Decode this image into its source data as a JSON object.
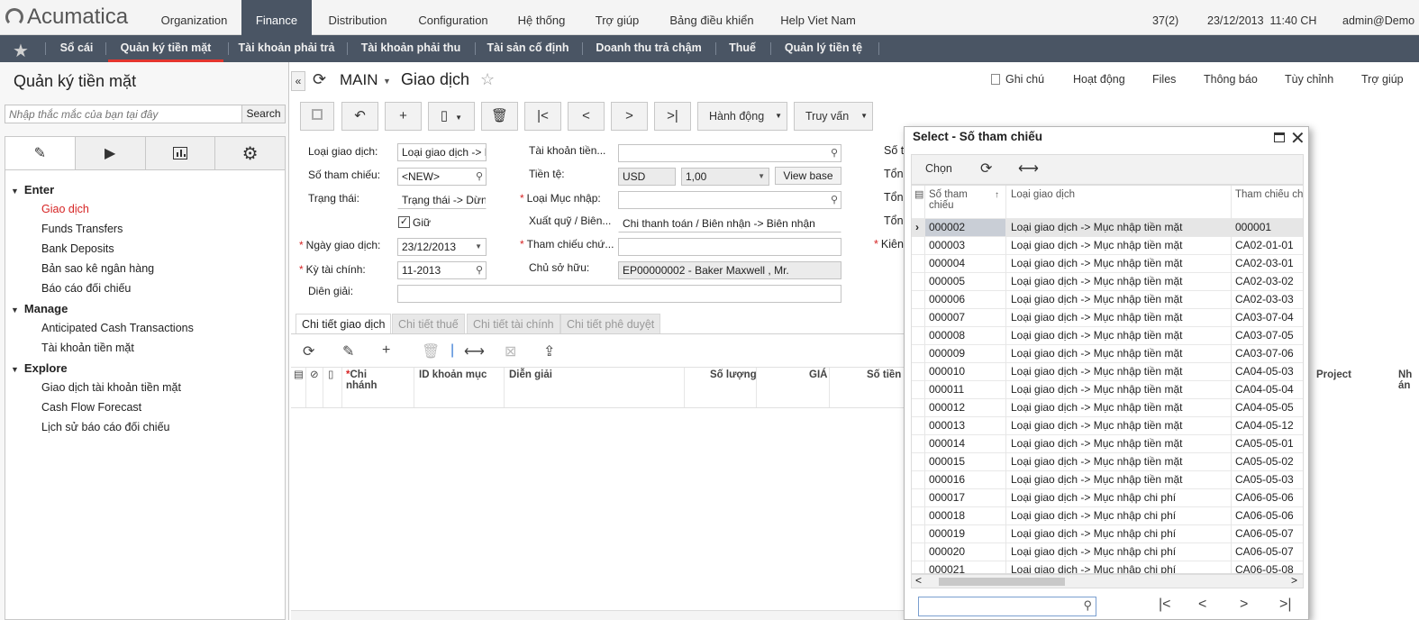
{
  "app": {
    "brand": "Acumatica"
  },
  "topnav": {
    "items": [
      "Organization",
      "Finance",
      "Distribution",
      "Configuration",
      "Hệ thống",
      "Trợ giúp",
      "Bảng điều khiển",
      "Help Viet Nam"
    ],
    "active": "Finance",
    "counter": "37(2)",
    "datetime": "23/12/2013  11:40 CH",
    "user": "admin@Demo"
  },
  "subnav": {
    "items": [
      "Sổ cái",
      "Quản ký tiền mặt",
      "Tài khoản phải trả",
      "Tài khoản phải thu",
      "Tài sản cố định",
      "Doanh thu trả chậm",
      "Thuế",
      "Quản lý tiền tệ"
    ],
    "active": "Quản ký tiền mặt"
  },
  "sidebar": {
    "title": "Quản ký tiền mặt",
    "search_placeholder": "Nhập thắc mắc của bạn tại đây",
    "search_button": "Search",
    "groups": [
      {
        "label": "Enter",
        "items": [
          "Giao dịch",
          "Funds Transfers",
          "Bank Deposits",
          "Bản sao kê ngân hàng",
          "Báo cáo đối chiếu"
        ]
      },
      {
        "label": "Manage",
        "items": [
          "Anticipated Cash Transactions",
          "Tài khoản tiền mặt"
        ]
      },
      {
        "label": "Explore",
        "items": [
          "Giao dịch tài khoản tiền mặt",
          "Cash Flow Forecast",
          "Lịch sử báo cáo đối chiếu"
        ]
      }
    ],
    "active_item": "Giao dịch"
  },
  "page": {
    "company": "MAIN",
    "title": "Giao dịch",
    "links": [
      "Ghi chú",
      "Hoạt động",
      "Files",
      "Thông báo",
      "Tùy chỉnh",
      "Trợ giúp"
    ],
    "toolbar": {
      "actions": "Hành động",
      "inquiry": "Truy vấn"
    }
  },
  "form": {
    "loai_giao_dich_label": "Loại giao dịch:",
    "loai_giao_dich_value": "Loại giao dịch -> Mục nhập tiền mặt",
    "so_tham_chieu_label": "Số tham chiếu:",
    "so_tham_chieu_value": "<NEW>",
    "trang_thai_label": "Trạng thái:",
    "trang_thai_value": "Trạng thái -> Dừng",
    "giu_label": "Giữ",
    "ngay_label": "Ngày giao dịch:",
    "ngay_value": "23/12/2013",
    "ky_label": "Kỳ tài chính:",
    "ky_value": "11-2013",
    "dien_giai_label": "Diên giải:",
    "tk_tien_label": "Tài khoản tiền...",
    "tien_te_label": "Tiền tệ:",
    "tien_te_value": "USD",
    "rate_value": "1,00",
    "view_base": "View base",
    "loai_muc_nhap_label": "Loại Mục nhập:",
    "xuat_quy_label": "Xuất quỹ / Biên...",
    "xuat_quy_value": "Chi thanh toán / Biên nhận -> Biên nhận",
    "tham_chieu_chu_label": "Tham chiếu chứ...",
    "chu_so_huu_label": "Chủ sở hữu:",
    "chu_so_huu_value": "EP00000002 - Baker Maxwell , Mr.",
    "right_labels": [
      "Số t",
      "Tổng",
      "Tổng",
      "Tổng",
      "Kiên"
    ]
  },
  "tabs": [
    "Chi tiết giao dịch",
    "Chi tiết thuế",
    "Chi tiết tài chính",
    "Chi tiết phê duyệt"
  ],
  "grid": {
    "headers": [
      "Chi nhánh",
      "ID khoản mục",
      "Diễn giải",
      "Số lượng",
      "GIÁ",
      "Số tiền",
      "Project",
      "Nh án"
    ]
  },
  "dialog": {
    "title": "Select - Số tham chiếu",
    "select_button": "Chọn",
    "headers": [
      "Số tham chiếu",
      "Loại giao dịch",
      "Tham chiếu chi"
    ],
    "rows": [
      [
        "000002",
        "Loại giao dịch -> Mục nhập tiền mặt",
        "000001"
      ],
      [
        "000003",
        "Loại giao dịch -> Mục nhập tiền mặt",
        "CA02-01-01"
      ],
      [
        "000004",
        "Loại giao dịch -> Mục nhập tiền mặt",
        "CA02-03-01"
      ],
      [
        "000005",
        "Loại giao dịch -> Mục nhập tiền mặt",
        "CA02-03-02"
      ],
      [
        "000006",
        "Loại giao dịch -> Mục nhập tiền mặt",
        "CA02-03-03"
      ],
      [
        "000007",
        "Loại giao dịch -> Mục nhập tiền mặt",
        "CA03-07-04"
      ],
      [
        "000008",
        "Loại giao dịch -> Mục nhập tiền mặt",
        "CA03-07-05"
      ],
      [
        "000009",
        "Loại giao dịch -> Mục nhập tiền mặt",
        "CA03-07-06"
      ],
      [
        "000010",
        "Loại giao dịch -> Mục nhập tiền mặt",
        "CA04-05-03"
      ],
      [
        "000011",
        "Loại giao dịch -> Mục nhập tiền mặt",
        "CA04-05-04"
      ],
      [
        "000012",
        "Loại giao dịch -> Mục nhập tiền mặt",
        "CA04-05-05"
      ],
      [
        "000013",
        "Loại giao dịch -> Mục nhập tiền mặt",
        "CA04-05-12"
      ],
      [
        "000014",
        "Loại giao dịch -> Mục nhập tiền mặt",
        "CA05-05-01"
      ],
      [
        "000015",
        "Loại giao dịch -> Mục nhập tiền mặt",
        "CA05-05-02"
      ],
      [
        "000016",
        "Loại giao dịch -> Mục nhập tiền mặt",
        "CA05-05-03"
      ],
      [
        "000017",
        "Loại giao dịch -> Mục nhập chi phí",
        "CA06-05-06"
      ],
      [
        "000018",
        "Loại giao dịch -> Mục nhập chi phí",
        "CA06-05-06"
      ],
      [
        "000019",
        "Loại giao dịch -> Mục nhập chi phí",
        "CA06-05-07"
      ],
      [
        "000020",
        "Loại giao dịch -> Mục nhập chi phí",
        "CA06-05-07"
      ],
      [
        "000021",
        "Loại giao dịch -> Mục nhập chi phí",
        "CA06-05-08"
      ]
    ],
    "selected_row": 0
  }
}
